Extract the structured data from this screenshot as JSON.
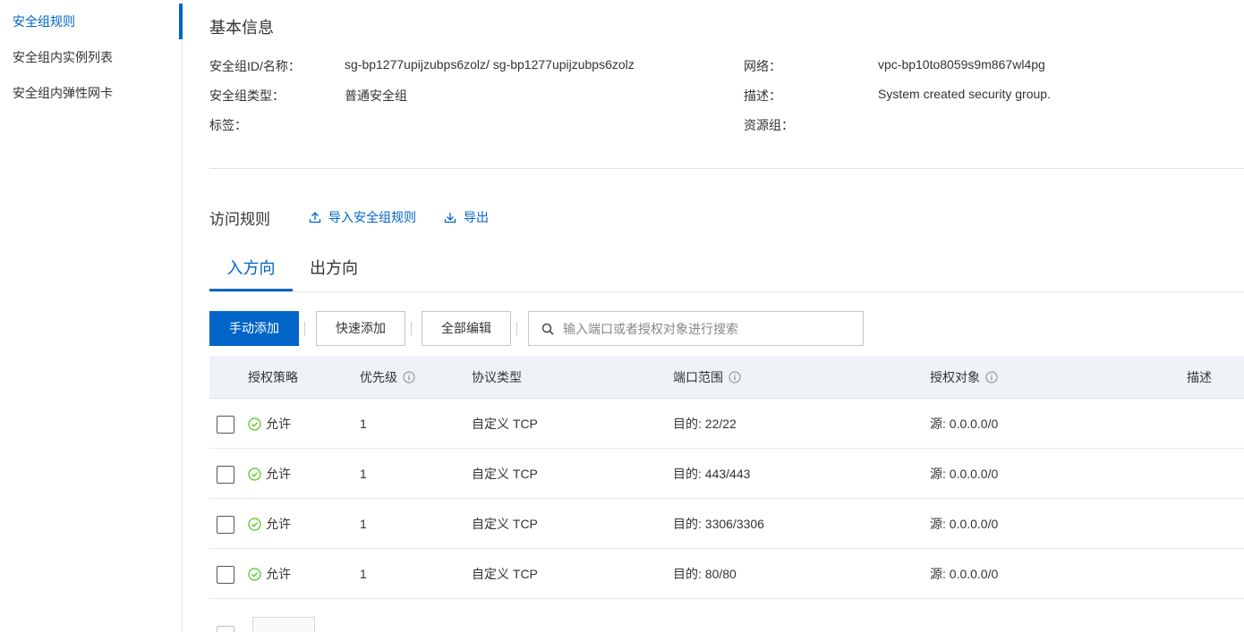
{
  "sidebar": {
    "items": [
      {
        "label": "安全组规则"
      },
      {
        "label": "安全组内实例列表"
      },
      {
        "label": "安全组内弹性网卡"
      }
    ]
  },
  "basic_info": {
    "title": "基本信息",
    "fields": [
      {
        "label": "安全组ID/名称：",
        "value": "sg-bp1277upijzubps6zolz/ sg-bp1277upijzubps6zolz"
      },
      {
        "label": "网络：",
        "value": "vpc-bp10to8059s9m867wl4pg"
      },
      {
        "label": "安全组类型：",
        "value": "普通安全组"
      },
      {
        "label": "描述：",
        "value": "System created security group."
      },
      {
        "label": "标签：",
        "value": ""
      },
      {
        "label": "资源组：",
        "value": ""
      }
    ]
  },
  "access_rules": {
    "title": "访问规则",
    "import_label": "导入安全组规则",
    "export_label": "导出"
  },
  "tabs": [
    {
      "label": "入方向",
      "active": true
    },
    {
      "label": "出方向",
      "active": false
    }
  ],
  "toolbar": {
    "manual_add": "手动添加",
    "quick_add": "快速添加",
    "edit_all": "全部编辑",
    "search_placeholder": "输入端口或者授权对象进行搜索"
  },
  "table": {
    "headers": [
      "授权策略",
      "优先级",
      "协议类型",
      "端口范围",
      "授权对象",
      "描述"
    ],
    "rows": [
      {
        "policy": "允许",
        "priority": "1",
        "protocol": "自定义 TCP",
        "port": "目的: 22/22",
        "source": "源: 0.0.0.0/0"
      },
      {
        "policy": "允许",
        "priority": "1",
        "protocol": "自定义 TCP",
        "port": "目的: 443/443",
        "source": "源: 0.0.0.0/0"
      },
      {
        "policy": "允许",
        "priority": "1",
        "protocol": "自定义 TCP",
        "port": "目的: 3306/3306",
        "source": "源: 0.0.0.0/0"
      },
      {
        "policy": "允许",
        "priority": "1",
        "protocol": "自定义 TCP",
        "port": "目的: 80/80",
        "source": "源: 0.0.0.0/0"
      }
    ]
  },
  "colors": {
    "accent": "#0064c8",
    "allow_green": "#52c41a"
  }
}
